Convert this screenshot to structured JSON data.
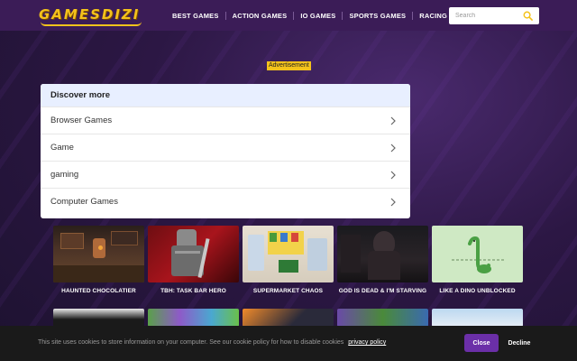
{
  "brand": {
    "logo_text": "GAMESDIZI"
  },
  "nav": {
    "items": [
      {
        "label": "BEST GAMES"
      },
      {
        "label": "ACTION GAMES"
      },
      {
        "label": "IO GAMES"
      },
      {
        "label": "SPORTS GAMES"
      },
      {
        "label": "RACING GAMES"
      }
    ]
  },
  "search": {
    "placeholder": "Search",
    "value": ""
  },
  "ad": {
    "label": "Advertisement"
  },
  "discover": {
    "title": "Discover more",
    "items": [
      {
        "label": "Browser Games"
      },
      {
        "label": "Game"
      },
      {
        "label": "gaming"
      },
      {
        "label": "Computer Games"
      }
    ]
  },
  "games": {
    "row1": [
      {
        "title": "HAUNTED CHOCOLATIER"
      },
      {
        "title": "TBH: TASK BAR HERO"
      },
      {
        "title": "SUPERMARKET CHAOS"
      },
      {
        "title": "GOD IS DEAD & I'M STARVING"
      },
      {
        "title": "LIKE A DINO UNBLOCKED"
      }
    ]
  },
  "cookie": {
    "text": "This site uses cookies to store information on your computer. See our cookie policy for how to disable cookies",
    "link": "privacy policy",
    "close_label": "Close",
    "decline_label": "Decline"
  },
  "colors": {
    "header_bg": "#3b1c57",
    "accent_yellow": "#f4c21b",
    "close_button": "#6b2fa8",
    "discover_header": "#e8efff"
  }
}
